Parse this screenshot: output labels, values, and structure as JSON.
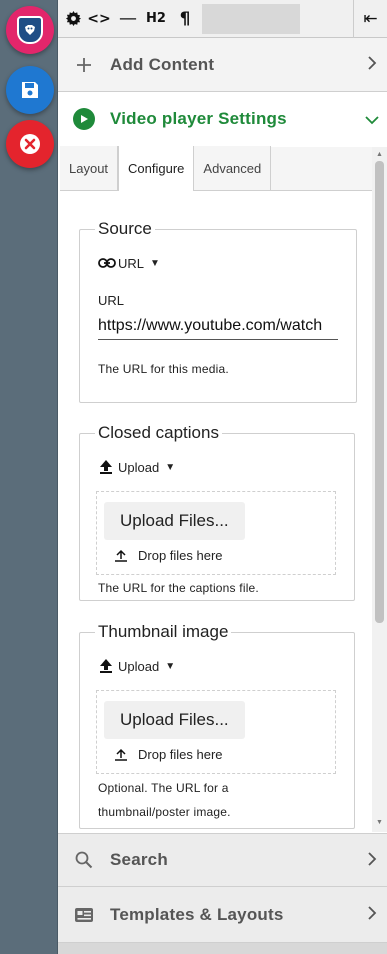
{
  "toolbar": {
    "h2_label": "H2",
    "paragraph_glyph": "¶",
    "code_glyph": "<>",
    "hr_glyph": "—",
    "collapse_glyph": "⇤"
  },
  "panels": {
    "add_content": "Add Content",
    "video_settings": "Video player Settings",
    "search": "Search",
    "templates": "Templates & Layouts"
  },
  "tabs": [
    "Layout",
    "Configure",
    "Advanced"
  ],
  "active_tab": "Configure",
  "source": {
    "legend": "Source",
    "mode": "URL",
    "url_label": "URL",
    "url_value": "https://www.youtube.com/watch",
    "helper": "The URL for this media."
  },
  "captions": {
    "legend": "Closed captions",
    "mode": "Upload",
    "upload_button": "Upload Files...",
    "drop_hint": "Drop files here",
    "helper": "The URL for the captions file."
  },
  "thumbnail": {
    "legend": "Thumbnail image",
    "mode": "Upload",
    "upload_button": "Upload Files...",
    "drop_hint": "Drop files here",
    "helper_line1": "Optional. The URL for a",
    "helper_line2": "thumbnail/poster image."
  },
  "colors": {
    "rail": "#5b6d7a",
    "logo_fab": "#e2266b",
    "save_fab": "#1f78d1",
    "cancel_fab": "#e4242d",
    "accent_green": "#1f8a3a"
  },
  "icons": {
    "logo": "shield-logo-icon",
    "save": "save-icon",
    "cancel": "close-circle-icon",
    "settings": "gear-icon",
    "add": "plus-icon",
    "video": "play-circle-icon",
    "search": "search-icon",
    "templates": "templates-icon",
    "link": "link-icon",
    "upload": "upload-icon"
  }
}
